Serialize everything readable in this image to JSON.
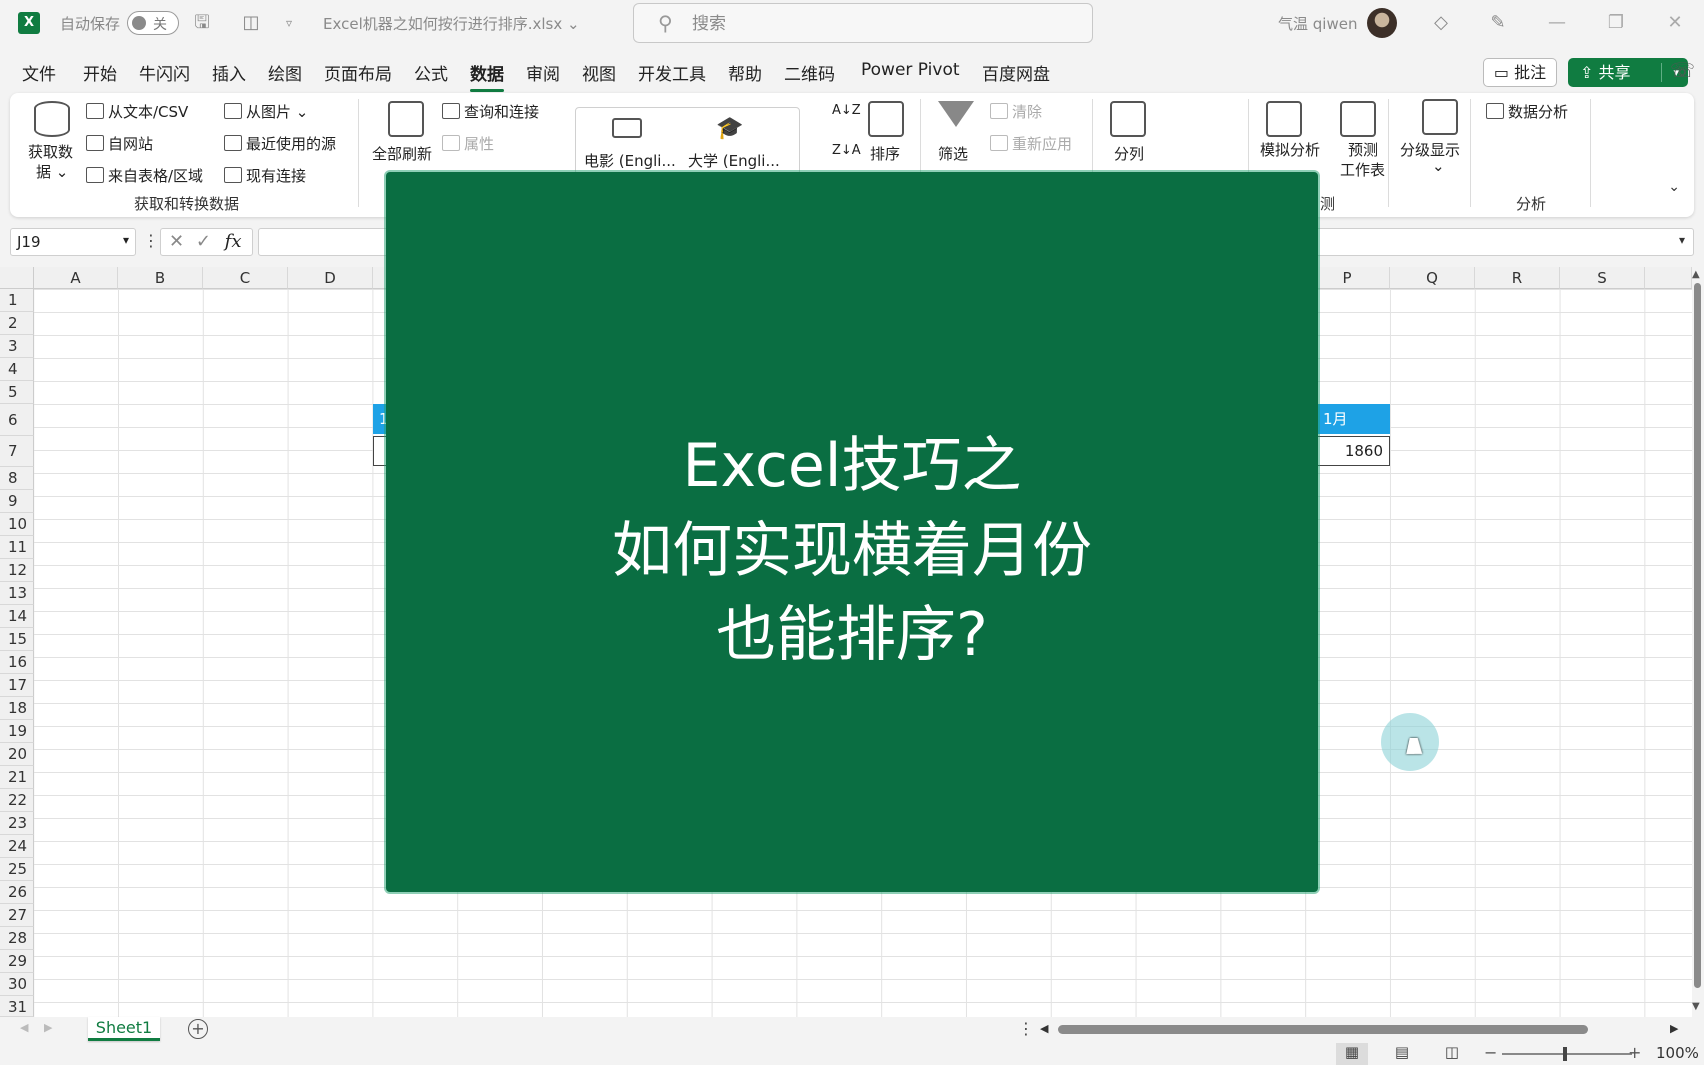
{
  "titlebar": {
    "app_logo": "X",
    "autosave_label": "自动保存",
    "autosave_state": "关",
    "filename": "Excel机器之如何按行进行排序.xlsx",
    "search_placeholder": "搜索",
    "username": "气温 qiwen"
  },
  "menu": {
    "tabs": [
      "文件",
      "开始",
      "牛闪闪",
      "插入",
      "绘图",
      "页面布局",
      "公式",
      "数据",
      "审阅",
      "视图",
      "开发工具",
      "帮助",
      "二维码",
      "Power Pivot",
      "百度网盘"
    ],
    "active_tab": "数据",
    "comment_label": "批注",
    "share_label": "共享"
  },
  "ribbon": {
    "get_data_1": "获取数",
    "get_data_2": "据",
    "from_text_csv": "从文本/CSV",
    "from_web": "自网站",
    "from_table": "来自表格/区域",
    "from_picture": "从图片",
    "recent_sources": "最近使用的源",
    "existing_connections": "现有连接",
    "group_get_transform": "获取和转换数据",
    "refresh_all": "全部刷新",
    "queries_connections": "查询和连接",
    "properties": "属性",
    "gallery_movie": "电影 (Engli...",
    "gallery_university": "大学 (Engli...",
    "sort": "排序",
    "filter": "筛选",
    "clear": "清除",
    "reapply": "重新应用",
    "text_to_columns": "分列",
    "what_if": "模拟分析",
    "forecast_1": "预测",
    "forecast_2": "工作表",
    "group_forecast_partial": "测",
    "outline": "分级显示",
    "data_analysis": "数据分析",
    "group_analysis": "分析"
  },
  "formula_bar": {
    "name_box": "J19",
    "fx_label": "fx",
    "formula": ""
  },
  "grid": {
    "columns": [
      "A",
      "B",
      "C",
      "D",
      "P",
      "Q",
      "R",
      "S"
    ],
    "rows": [
      "1",
      "2",
      "3",
      "4",
      "5",
      "6",
      "7",
      "8",
      "9",
      "10",
      "11",
      "12",
      "13",
      "14",
      "15",
      "16",
      "17",
      "18",
      "19",
      "20",
      "21",
      "22",
      "23",
      "24",
      "25",
      "26",
      "27",
      "28",
      "29",
      "30",
      "31"
    ],
    "table_left_header": "1",
    "table_right_header": "1月",
    "table_right_value": "1860"
  },
  "overlay": {
    "line1": "Excel技巧之",
    "line2": "如何实现横着月份",
    "line3": "也能排序?",
    "background_color": "#0a6e42"
  },
  "sheets": {
    "tabs": [
      "Sheet1"
    ],
    "add_label": "+"
  },
  "status": {
    "zoom_level": "100%"
  },
  "colors": {
    "accent": "#107c41",
    "table_header": "#1ea2e6"
  }
}
